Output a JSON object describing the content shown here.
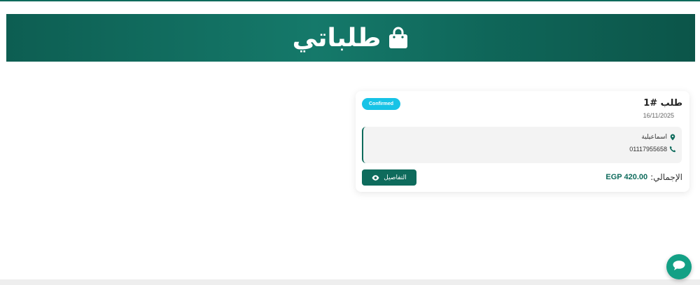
{
  "header": {
    "title": "طلباتي"
  },
  "order": {
    "title": "طلب #1",
    "date": "16/11/2025",
    "status": "Confirmed",
    "city": "اسماعيلية",
    "phone": "01117955658",
    "total_label": "الإجمالي:",
    "total_value": "EGP 420.00",
    "details_label": "التفاصيل"
  },
  "colors": {
    "primary": "#0e6b5c",
    "status_badge": "#17c3e6",
    "chat_button": "#13a085"
  },
  "icons": [
    "shopping-bag-icon",
    "map-pin-icon",
    "phone-icon",
    "eye-icon",
    "chat-icon"
  ]
}
